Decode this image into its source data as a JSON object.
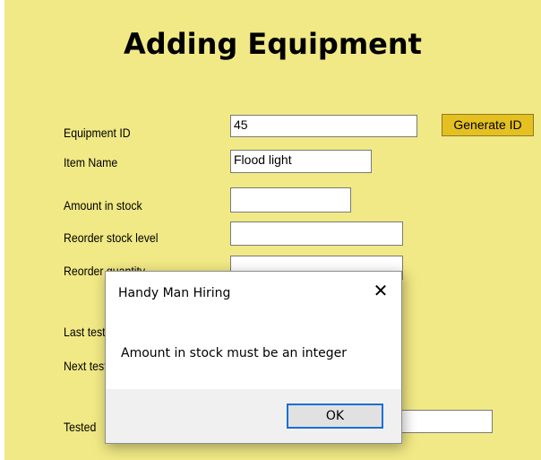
{
  "form": {
    "title": "Adding Equipment",
    "generate_button": "Generate ID",
    "fields": [
      {
        "label": "Equipment ID",
        "value": "45"
      },
      {
        "label": "Item Name",
        "value": "Flood light"
      },
      {
        "label": "Amount in stock",
        "value": ""
      },
      {
        "label": "Reorder stock level",
        "value": ""
      },
      {
        "label": "Reorder quantity",
        "value": ""
      },
      {
        "label": "Last tested",
        "value": ""
      },
      {
        "label": "Next test",
        "value": ""
      },
      {
        "label": "Tested",
        "value": ""
      }
    ]
  },
  "dialog": {
    "title": "Handy Man Hiring",
    "close_glyph": "✕",
    "message": "Amount in stock must be an integer",
    "ok_label": "OK"
  }
}
